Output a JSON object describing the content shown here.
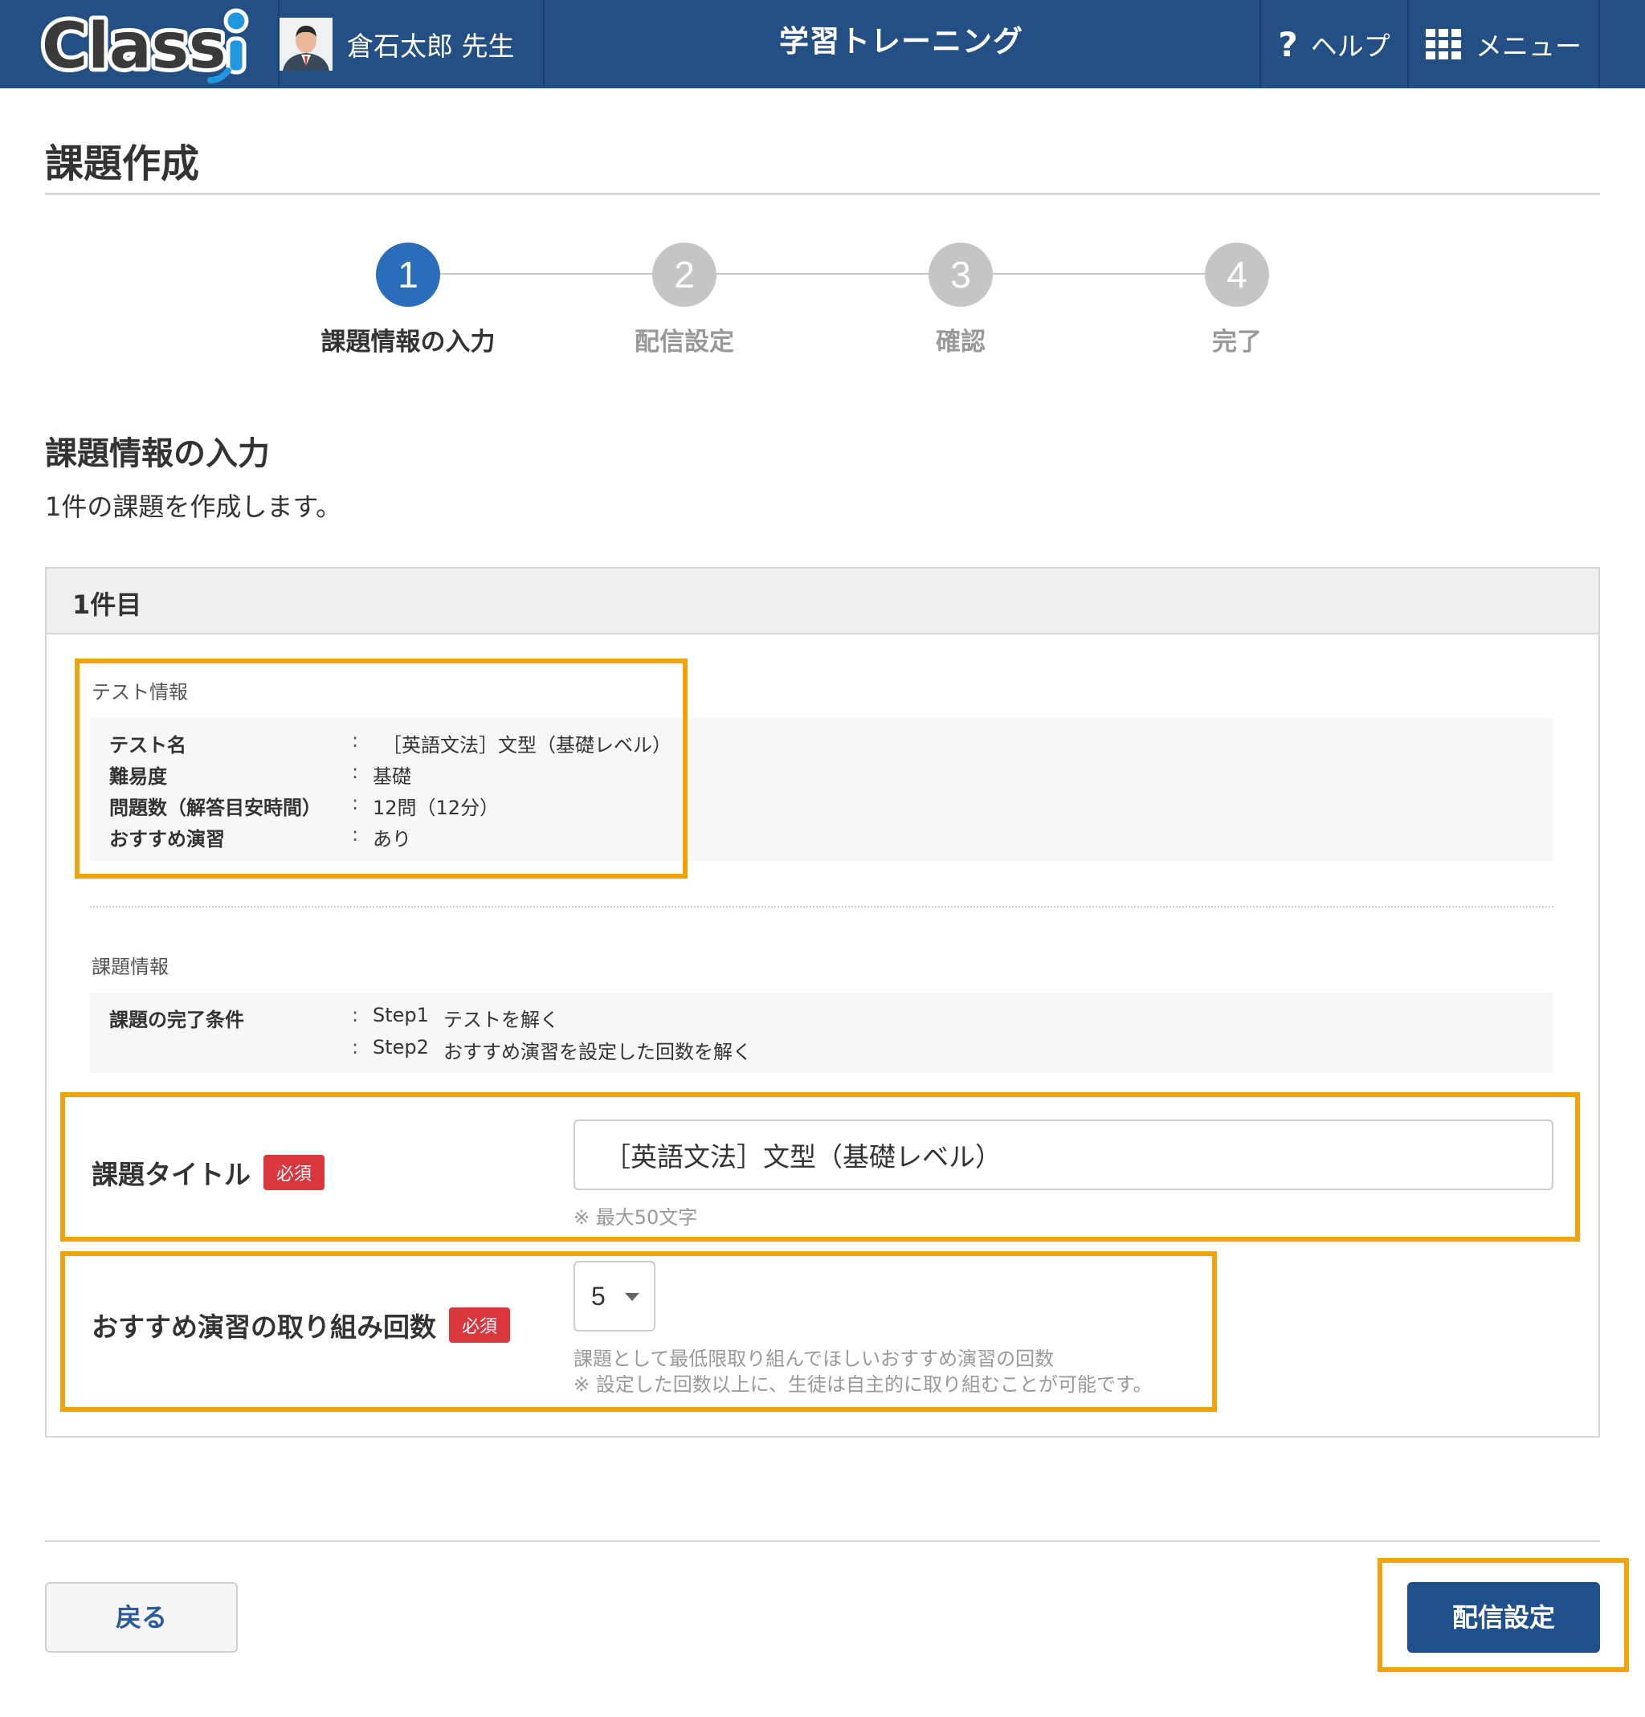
{
  "header": {
    "logo_text": "Classi",
    "user_name": "倉石太郎 先生",
    "app_title": "学習トレーニング",
    "help_label": "ヘルプ",
    "menu_label": "メニュー"
  },
  "page": {
    "title": "課題作成"
  },
  "stepper": {
    "current_step": 1,
    "steps": [
      {
        "number": "1",
        "label": "課題情報の入力"
      },
      {
        "number": "2",
        "label": "配信設定"
      },
      {
        "number": "3",
        "label": "確認"
      },
      {
        "number": "4",
        "label": "完了"
      }
    ]
  },
  "section": {
    "heading": "課題情報の入力",
    "description": "1件の課題を作成します。"
  },
  "card": {
    "header": "1件目",
    "test_info": {
      "label": "テスト情報",
      "rows": [
        {
          "key": "テスト名",
          "colon": ":",
          "value": "［英語文法］文型（基礎レベル）"
        },
        {
          "key": "難易度",
          "colon": ":",
          "value": "基礎"
        },
        {
          "key": "問題数（解答目安時間）",
          "colon": ":",
          "value": "12問（12分）"
        },
        {
          "key": "おすすめ演習",
          "colon": ":",
          "value": "あり"
        }
      ]
    },
    "task_info": {
      "label": "課題情報",
      "key": "課題の完了条件",
      "steps": [
        {
          "colon": ":",
          "step": "Step1",
          "text": "テストを解く"
        },
        {
          "colon": ":",
          "step": "Step2",
          "text": "おすすめ演習を設定した回数を解く"
        }
      ]
    },
    "title_field": {
      "label": "課題タイトル",
      "required": "必須",
      "value": "［英語文法］文型（基礎レベル）",
      "hint": "※ 最大50文字"
    },
    "count_field": {
      "label": "おすすめ演習の取り組み回数",
      "required": "必須",
      "value": "5",
      "hint_1": "課題として最低限取り組んでほしいおすすめ演習の回数",
      "hint_2": "※ 設定した回数以上に、生徒は自主的に取り組むことが可能です。"
    }
  },
  "footer": {
    "back_label": "戻る",
    "next_label": "配信設定"
  },
  "colors": {
    "header_bg": "#234f84",
    "active_step": "#2a6db8",
    "inactive_step": "#c5c5c5",
    "required_badge": "#d9363e",
    "primary_button": "#1f4f8d",
    "highlight": "#f0a30a"
  }
}
